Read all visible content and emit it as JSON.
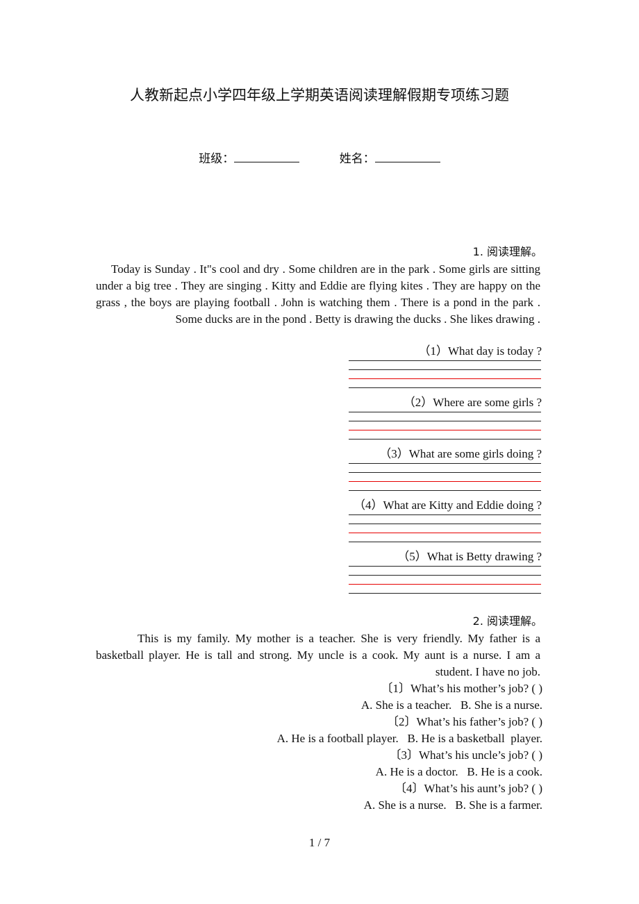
{
  "document": {
    "title": "人教新起点小学四年级上学期英语阅读理解假期专项练习题",
    "class_label": "班级：",
    "name_label": "姓名："
  },
  "section1": {
    "heading": "1. 阅读理解。",
    "passage": "Today is Sunday . It\"s cool and dry . Some children are in the park . Some girls are sitting under a big tree . They are singing . Kitty and Eddie are flying kites . They are happy on the grass , the boys are playing football . John is watching them . There is a pond in the park . Some ducks are in the pond . Betty is drawing the ducks . She likes drawing .",
    "questions": [
      {
        "text": "（1）What day is today ?"
      },
      {
        "text": "（2）Where are some girls ?"
      },
      {
        "text": "（3）What are some girls doing ?"
      },
      {
        "text": "（4）What are Kitty and Eddie doing ?"
      },
      {
        "text": "（5）What is Betty drawing ?"
      }
    ]
  },
  "section2": {
    "heading": "2. 阅读理解。",
    "passage": "This is my family. My mother is a teacher. She is very friendly. My father is a basketball player. He is tall and strong. My uncle is a cook. My aunt is a nurse. I am a student. I have no job.",
    "questions": [
      {
        "text": "〔1〕What’s his mother’s job? (   )",
        "options": "A. She is a teacher.   B. She is a nurse."
      },
      {
        "text": "〔2〕What’s his father’s job? (   )",
        "options": "A. He is a football player.   B. He is a basketball  player."
      },
      {
        "text": "〔3〕What’s his uncle’s job? (   )",
        "options": "A. He is a doctor.   B. He is a cook."
      },
      {
        "text": "〔4〕What’s his aunt’s job? (   )",
        "options": "A. She is a nurse.   B. She is a farmer."
      }
    ]
  },
  "footer": {
    "page_number": "1 / 7"
  },
  "colors": {
    "text": "#111111",
    "answer_line": "#222222",
    "answer_line_accent": "#e60000"
  }
}
